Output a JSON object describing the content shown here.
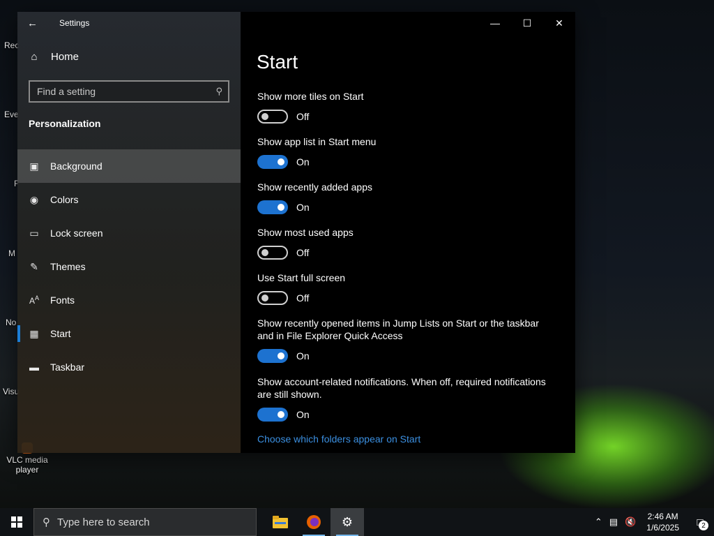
{
  "desktop": {
    "labels": [
      "Rec",
      "Eve",
      "F",
      "M",
      "No",
      "Visu"
    ],
    "vlc": "VLC media player"
  },
  "window": {
    "app_title": "Settings",
    "controls": {
      "minimize": "—",
      "maximize": "☐",
      "close": "✕"
    }
  },
  "nav": {
    "home": "Home",
    "search_placeholder": "Find a setting",
    "section": "Personalization",
    "items": [
      {
        "label": "Background",
        "icon": "image-icon"
      },
      {
        "label": "Colors",
        "icon": "palette-icon"
      },
      {
        "label": "Lock screen",
        "icon": "lock-screen-icon"
      },
      {
        "label": "Themes",
        "icon": "brush-icon"
      },
      {
        "label": "Fonts",
        "icon": "fonts-icon"
      },
      {
        "label": "Start",
        "icon": "start-icon"
      },
      {
        "label": "Taskbar",
        "icon": "taskbar-icon"
      }
    ]
  },
  "content": {
    "title": "Start",
    "options": [
      {
        "label": "Show more tiles on Start",
        "state": "Off"
      },
      {
        "label": "Show app list in Start menu",
        "state": "On"
      },
      {
        "label": "Show recently added apps",
        "state": "On"
      },
      {
        "label": "Show most used apps",
        "state": "Off"
      },
      {
        "label": "Use Start full screen",
        "state": "Off"
      },
      {
        "label": "Show recently opened items in Jump Lists on Start or the taskbar and in File Explorer Quick Access",
        "state": "On"
      },
      {
        "label": "Show account-related notifications. When off, required notifications are still shown.",
        "state": "On"
      }
    ],
    "link": "Choose which folders appear on Start",
    "accent": "#1d72d0",
    "link_color": "#3b8fe0"
  },
  "taskbar": {
    "search_placeholder": "Type here to search",
    "time": "2:46 AM",
    "date": "1/6/2025",
    "notification_count": "2"
  }
}
